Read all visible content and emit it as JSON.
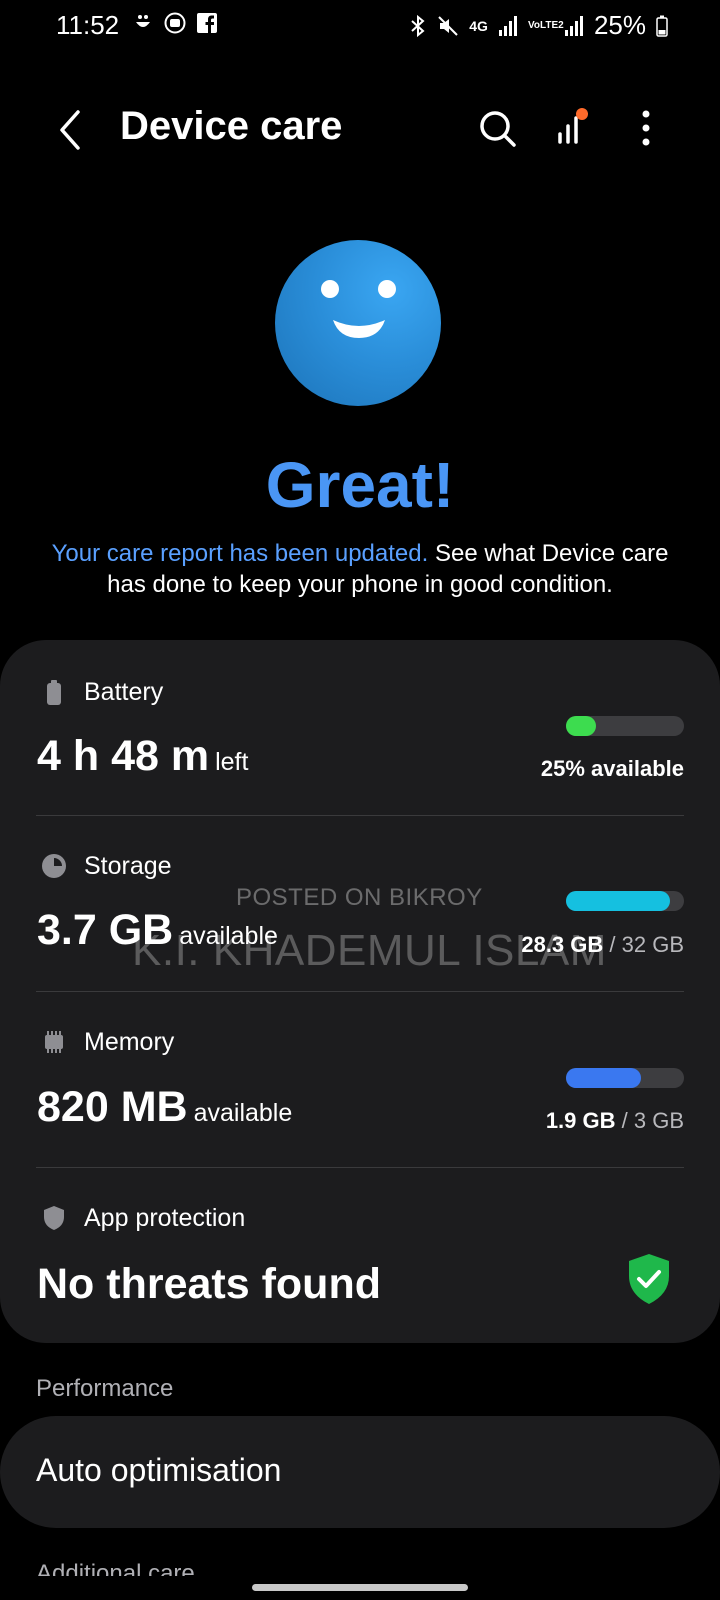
{
  "status_bar": {
    "time": "11:52",
    "network": "4G",
    "volte": "VoLTE2",
    "battery": "25%"
  },
  "header": {
    "title": "Device care",
    "icons": [
      "back-icon",
      "search-icon",
      "stats-icon",
      "more-icon"
    ],
    "notification_dot_color": "#ff6a2a"
  },
  "hero": {
    "headline": "Great!",
    "subtitle_link": "Your care report has been updated.",
    "subtitle_rest": " See what Device care has done to keep your phone in good condition."
  },
  "battery": {
    "label": "Battery",
    "value": "4 h 48 m",
    "unit": "left",
    "caption": "25% available",
    "level": 0.25,
    "color": "#3ddc4f"
  },
  "storage": {
    "label": "Storage",
    "value": "3.7 GB",
    "unit": "available",
    "used": "28.3 GB",
    "total": "/ 32 GB",
    "level": 0.884,
    "color": "#15c0e0"
  },
  "memory": {
    "label": "Memory",
    "value": "820 MB",
    "unit": "available",
    "used": "1.9 GB",
    "total": "/ 3 GB",
    "level": 0.633,
    "color": "#3a78f0"
  },
  "app_protection": {
    "label": "App protection",
    "status": "No threats found",
    "color": "#1fb84b"
  },
  "performance": {
    "section_label": "Performance",
    "item": "Auto optimisation"
  },
  "additional": {
    "section_label": "Additional care"
  },
  "watermark": {
    "line1": "POSTED ON BIKROY",
    "line2": "K.I. KHADEMUL ISLAM"
  },
  "colors": {
    "accent": "#4a96f5",
    "card": "#1c1c1e",
    "background": "#000000"
  }
}
